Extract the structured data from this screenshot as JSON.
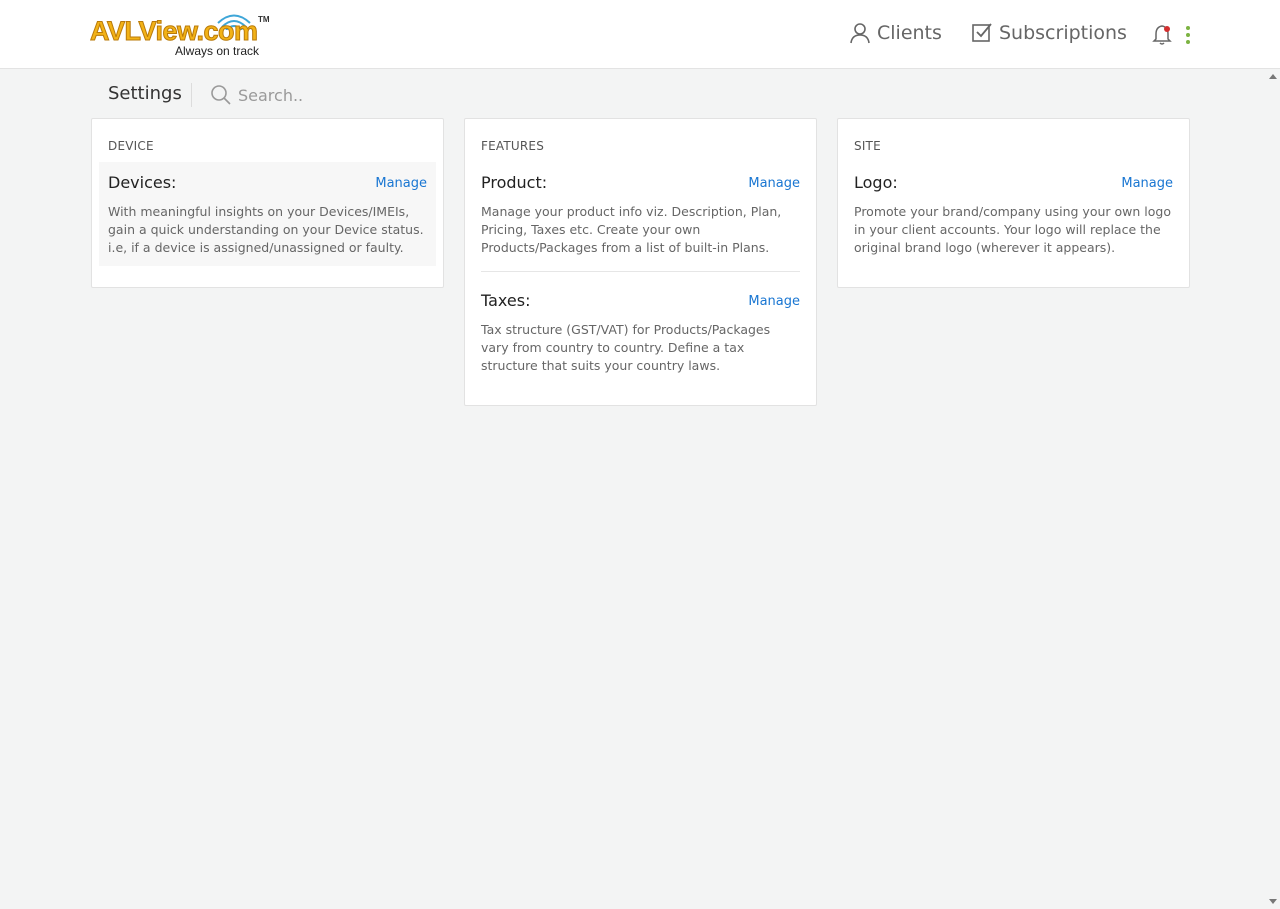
{
  "brand": {
    "name": "AVLView.com",
    "trademark": "TM",
    "tagline": "Always on track"
  },
  "nav": {
    "clients": "Clients",
    "subscriptions": "Subscriptions",
    "icons": [
      "user-icon",
      "checkbox-icon",
      "bell-icon",
      "kebab-menu-icon"
    ],
    "notification_dot_color": "#d32f2f",
    "kebab_color": "#7cb342"
  },
  "toolbar": {
    "title": "Settings",
    "search_placeholder": "Search.."
  },
  "cards": {
    "device": {
      "heading": "DEVICE",
      "items": [
        {
          "title": "Devices:",
          "link": "Manage",
          "description": "With meaningful insights on your Devices/IMEIs, gain a quick understanding on your Device status. i.e, if a device is assigned/unassigned or faulty."
        }
      ]
    },
    "features": {
      "heading": "FEATURES",
      "items": [
        {
          "title": "Product:",
          "link": "Manage",
          "description": "Manage your product info viz. Description, Plan, Pricing, Taxes etc. Create your own Products/Packages from a list of built-in Plans."
        },
        {
          "title": "Taxes:",
          "link": "Manage",
          "description": "Tax structure (GST/VAT) for Products/Packages vary from country to country. Define a tax structure that suits your country laws."
        }
      ]
    },
    "site": {
      "heading": "SITE",
      "items": [
        {
          "title": "Logo:",
          "link": "Manage",
          "description": "Promote your brand/company using your own logo in your client accounts. Your logo will replace the original brand logo (wherever it appears)."
        }
      ]
    }
  },
  "colors": {
    "link": "#1976d2",
    "logo_primary": "#f2b217",
    "background": "#f3f4f4"
  }
}
